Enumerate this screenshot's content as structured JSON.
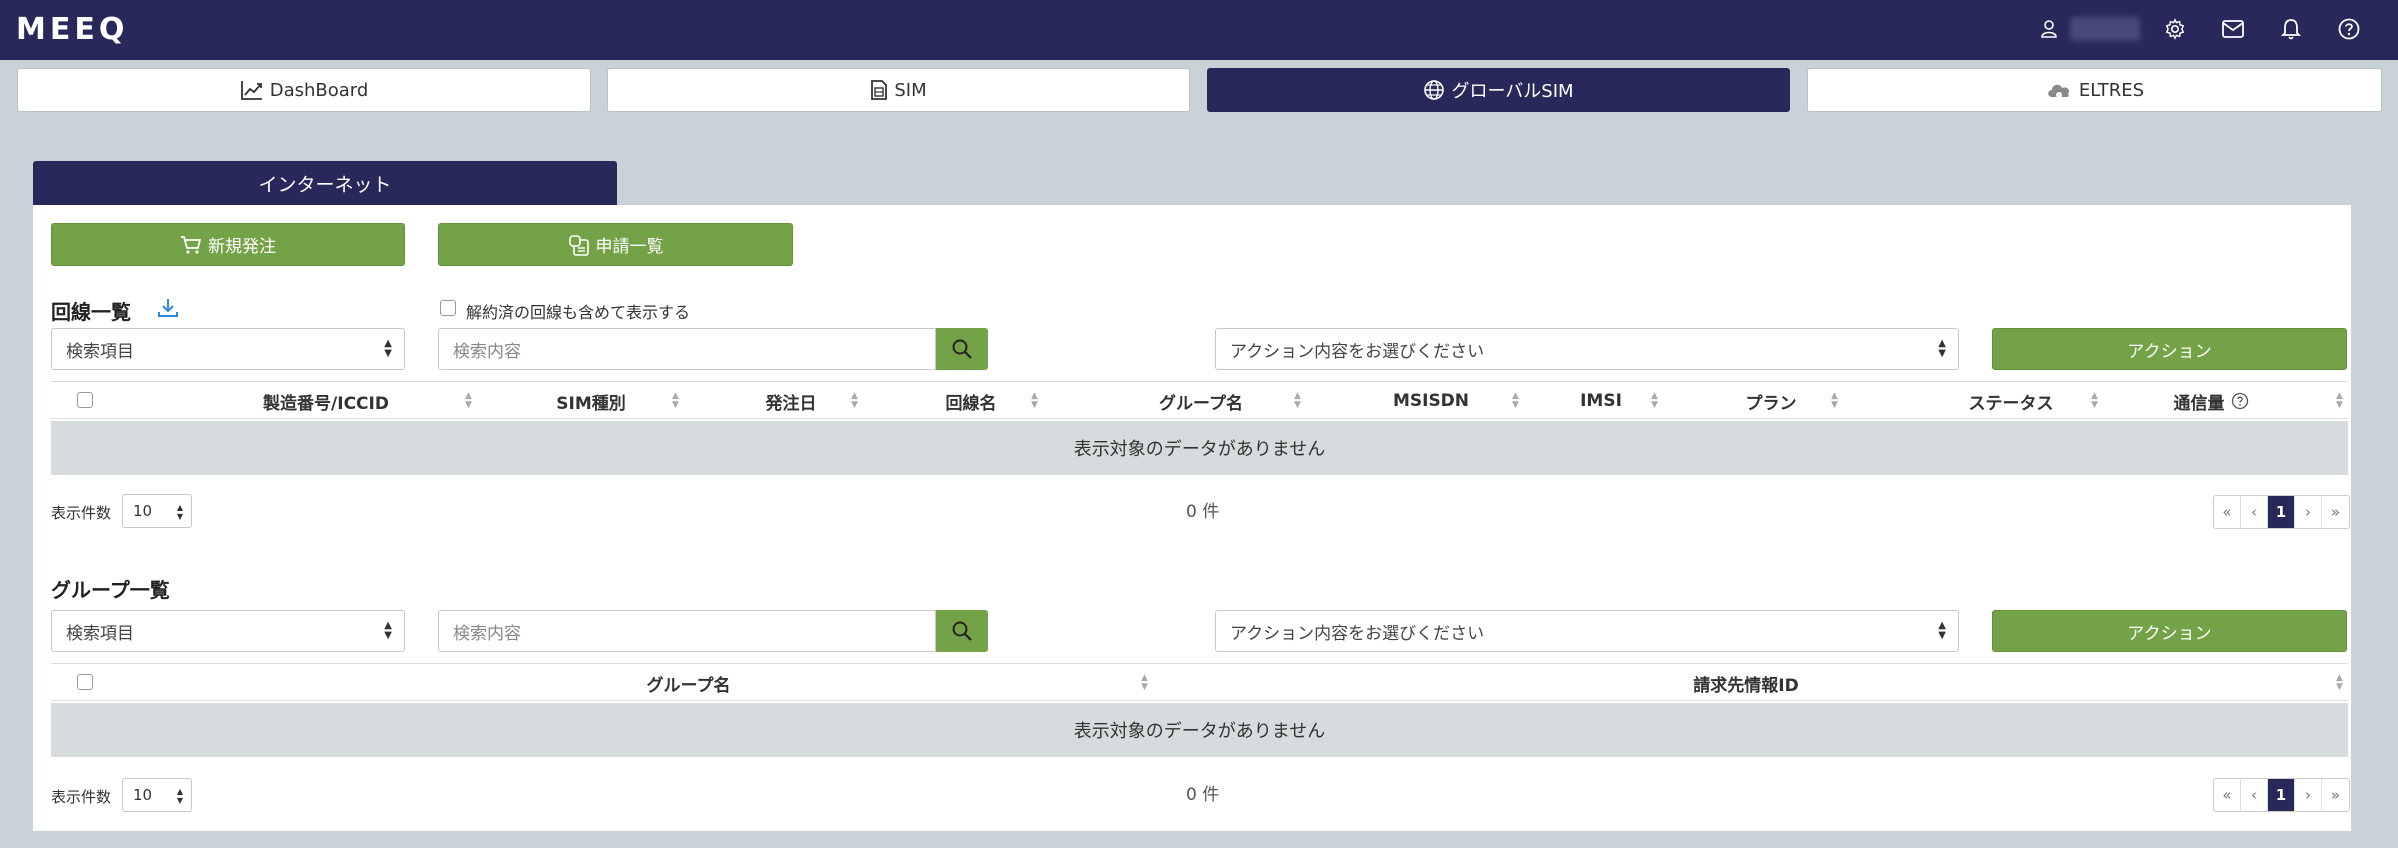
{
  "header": {
    "logo": "MEEQ",
    "icons": [
      "user-icon",
      "gear-icon",
      "mail-icon",
      "bell-icon",
      "help-icon"
    ]
  },
  "nav": {
    "tabs": [
      {
        "label": "DashBoard",
        "icon": "chart-line-icon"
      },
      {
        "label": "SIM",
        "icon": "sim-card-icon"
      },
      {
        "label": "グローバルSIM",
        "icon": "globe-icon",
        "active": true
      },
      {
        "label": "ELTRES",
        "icon": "cloud-icon"
      }
    ]
  },
  "innertab": {
    "label": "インターネット"
  },
  "buttons": {
    "new_order": "新規発注",
    "request_list": "申請一覧"
  },
  "lines": {
    "title": "回線一覧",
    "include_cancelled": "解約済の回線も含めて表示する",
    "search_field": "検索項目",
    "search_placeholder": "検索内容",
    "action_select": "アクション内容をお選びください",
    "action_button": "アクション",
    "columns": [
      "製造番号/ICCID",
      "SIM種別",
      "発注日",
      "回線名",
      "グループ名",
      "MSISDN",
      "IMSI",
      "プラン",
      "ステータス",
      "通信量"
    ],
    "empty": "表示対象のデータがありません",
    "per_page_label": "表示件数",
    "per_page": "10",
    "count": "0 件",
    "pager": [
      "«",
      "‹",
      "1",
      "›",
      "»"
    ]
  },
  "groups": {
    "title": "グループ一覧",
    "search_field": "検索項目",
    "search_placeholder": "検索内容",
    "action_select": "アクション内容をお選びください",
    "action_button": "アクション",
    "columns": [
      "グループ名",
      "請求先情報ID"
    ],
    "empty": "表示対象のデータがありません",
    "per_page_label": "表示件数",
    "per_page": "10",
    "count": "0 件",
    "pager": [
      "«",
      "‹",
      "1",
      "›",
      "»"
    ]
  },
  "colors": {
    "navy": "#29285a",
    "green": "#74a247",
    "background": "#c9d2d6"
  }
}
